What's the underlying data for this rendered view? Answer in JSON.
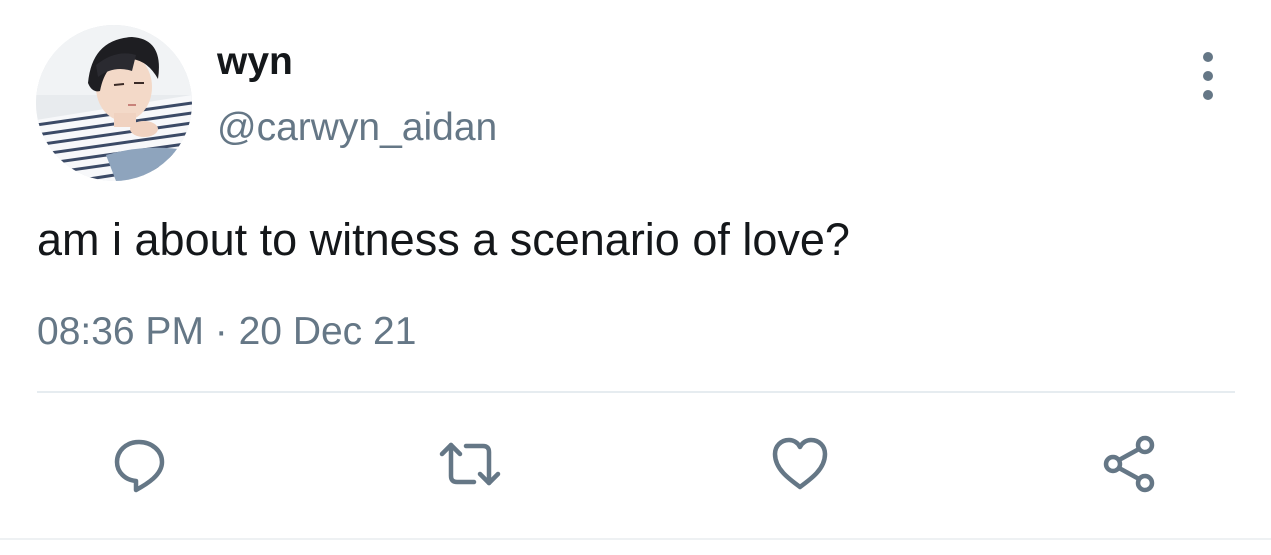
{
  "tweet": {
    "display_name": "wyn",
    "handle": "@carwyn_aidan",
    "text": "am i about to witness a scenario of love?",
    "time": "08:36 PM",
    "separator": " · ",
    "date": "20 Dec 21"
  },
  "actions": [
    {
      "name": "reply",
      "icon": "speech-bubble-icon"
    },
    {
      "name": "retweet",
      "icon": "retweet-icon"
    },
    {
      "name": "like",
      "icon": "heart-icon"
    },
    {
      "name": "share",
      "icon": "share-icon"
    }
  ],
  "colors": {
    "text_primary": "#14171a",
    "text_secondary": "#657786",
    "divider": "#e6ecf0",
    "background": "#ffffff"
  }
}
